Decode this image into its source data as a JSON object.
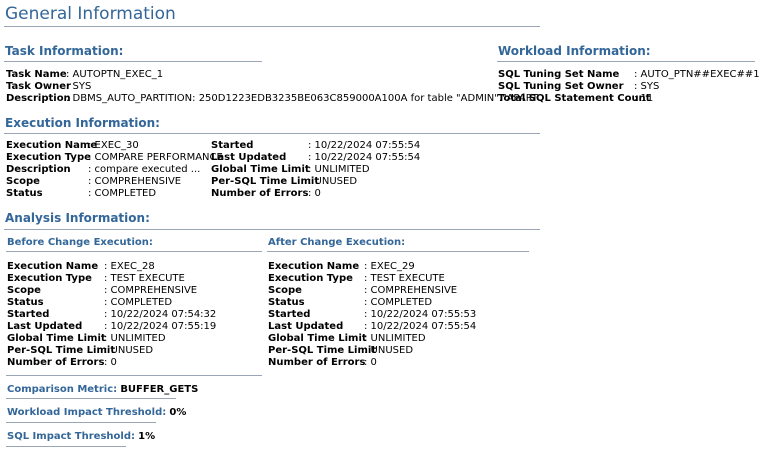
{
  "title": "General Information",
  "task": {
    "heading": "Task Information:",
    "name_label": "Task Name",
    "name_value": ": AUTOPTN_EXEC_1",
    "owner_label": "Task Owner",
    "owner_value": ": SYS",
    "desc_label": "Description",
    "desc_value": ": DBMS_AUTO_PARTITION: 250D1223EDB3235BE063C859000A100A for table \"ADMIN\".\"APART"
  },
  "workload": {
    "heading": "Workload Information:",
    "set_name_label": "SQL Tuning Set Name",
    "set_name_value": ": AUTO_PTN##EXEC##1",
    "set_owner_label": "SQL Tuning Set Owner",
    "set_owner_value": ": SYS",
    "count_label": "Total SQL Statement Count",
    "count_value": ": 11"
  },
  "execution": {
    "heading": "Execution Information:",
    "left": [
      {
        "label": "Execution Name",
        "value": ": EXEC_30"
      },
      {
        "label": "Execution Type",
        "value": ": COMPARE PERFORMANCE"
      },
      {
        "label": "Description",
        "value": ": compare executed ..."
      },
      {
        "label": "Scope",
        "value": ": COMPREHENSIVE"
      },
      {
        "label": "Status",
        "value": ": COMPLETED"
      }
    ],
    "right": [
      {
        "label": "Started",
        "value": ": 10/22/2024 07:55:54"
      },
      {
        "label": "Last Updated",
        "value": ": 10/22/2024 07:55:54"
      },
      {
        "label": "Global Time Limit",
        "value": ": UNLIMITED"
      },
      {
        "label": "Per-SQL Time Limit",
        "value": ": UNUSED"
      },
      {
        "label": "Number of Errors",
        "value": ": 0"
      }
    ]
  },
  "analysis": {
    "heading": "Analysis Information:",
    "before": {
      "heading": "Before Change Execution:",
      "rows": [
        {
          "label": "Execution Name",
          "value": ": EXEC_28"
        },
        {
          "label": "Execution Type",
          "value": ": TEST EXECUTE"
        },
        {
          "label": "Scope",
          "value": ": COMPREHENSIVE"
        },
        {
          "label": "Status",
          "value": ": COMPLETED"
        },
        {
          "label": "Started",
          "value": ": 10/22/2024 07:54:32"
        },
        {
          "label": "Last Updated",
          "value": ": 10/22/2024 07:55:19"
        },
        {
          "label": "Global Time Limit",
          "value": ": UNLIMITED"
        },
        {
          "label": "Per-SQL Time Limit",
          "value": ": UNUSED"
        },
        {
          "label": "Number of Errors",
          "value": ": 0"
        }
      ]
    },
    "after": {
      "heading": "After Change Execution:",
      "rows": [
        {
          "label": "Execution Name",
          "value": ": EXEC_29"
        },
        {
          "label": "Execution Type",
          "value": ": TEST EXECUTE"
        },
        {
          "label": "Scope",
          "value": ": COMPREHENSIVE"
        },
        {
          "label": "Status",
          "value": ": COMPLETED"
        },
        {
          "label": "Started",
          "value": ": 10/22/2024 07:55:53"
        },
        {
          "label": "Last Updated",
          "value": ": 10/22/2024 07:55:54"
        },
        {
          "label": "Global Time Limit",
          "value": ": UNLIMITED"
        },
        {
          "label": "Per-SQL Time Limit",
          "value": ": UNUSED"
        },
        {
          "label": "Number of Errors",
          "value": ": 0"
        }
      ]
    },
    "comparison_metric_label": "Comparison Metric:",
    "comparison_metric_value": "BUFFER_GETS",
    "workload_threshold_label": "Workload Impact Threshold:",
    "workload_threshold_value": "0%",
    "sql_threshold_label": "SQL Impact Threshold:",
    "sql_threshold_value": "1%"
  }
}
